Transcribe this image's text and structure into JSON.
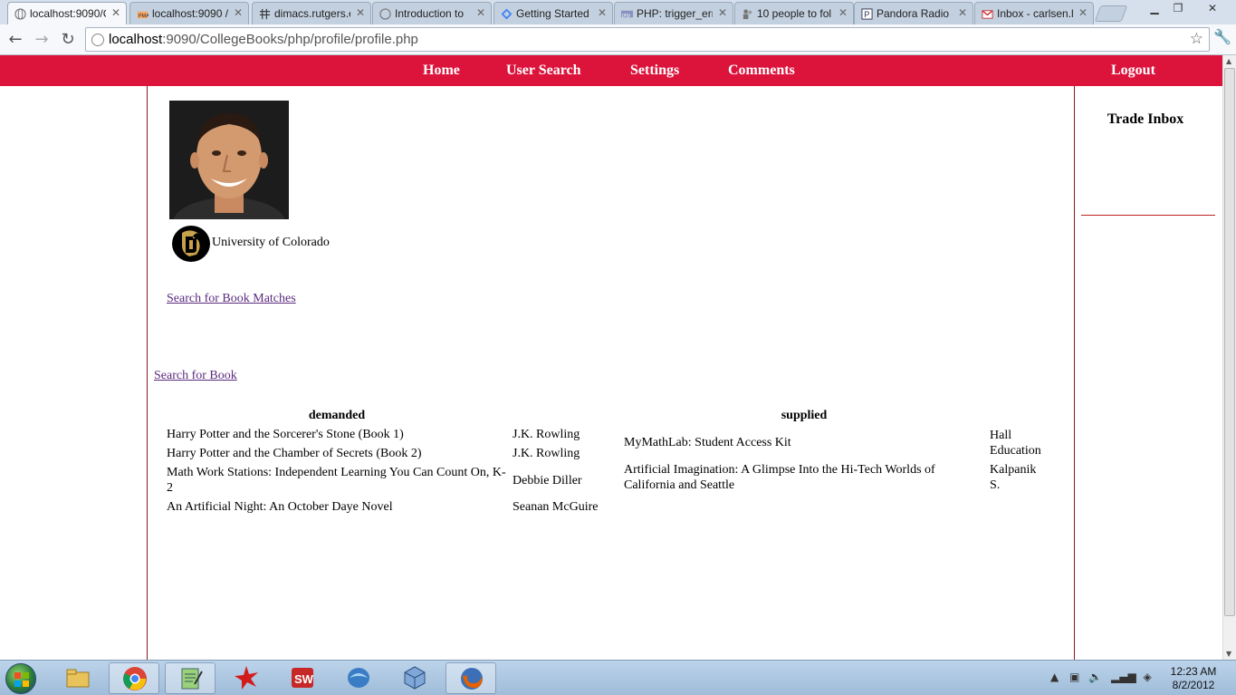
{
  "browser": {
    "tabs": [
      {
        "title": "localhost:9090/C",
        "active": true,
        "icon": "globe-icon"
      },
      {
        "title": "localhost:9090 /",
        "active": false,
        "icon": "phpmyadmin-icon"
      },
      {
        "title": "dimacs.rutgers.e",
        "active": false,
        "icon": "grid-icon"
      },
      {
        "title": "Introduction to",
        "active": false,
        "icon": "globe-icon"
      },
      {
        "title": "Getting Started",
        "active": false,
        "icon": "google-icon"
      },
      {
        "title": "PHP: trigger_err",
        "active": false,
        "icon": "php-icon"
      },
      {
        "title": "10 people to fol",
        "active": false,
        "icon": "people-icon"
      },
      {
        "title": "Pandora Radio -",
        "active": false,
        "icon": "pandora-icon"
      },
      {
        "title": "Inbox - carlsen.l",
        "active": false,
        "icon": "gmail-icon"
      }
    ],
    "url_host": "localhost",
    "url_rest": ":9090/CollegeBooks/php/profile/profile.php"
  },
  "nav": {
    "home": "Home",
    "user_search": "User Search",
    "settings": "Settings",
    "comments": "Comments",
    "logout": "Logout"
  },
  "profile": {
    "school_name": "University of Colorado",
    "search_matches_link": "Search for Book Matches",
    "search_book_link": "Search for Book"
  },
  "demanded": {
    "header": "demanded",
    "rows": [
      {
        "title": "Harry Potter and the Sorcerer's Stone (Book 1)",
        "author": "J.K. Rowling"
      },
      {
        "title": "Harry Potter and the Chamber of Secrets (Book 2)",
        "author": "J.K. Rowling"
      },
      {
        "title": "Math Work Stations: Independent Learning You Can Count On, K-2",
        "author": "Debbie Diller"
      },
      {
        "title": "An Artificial Night: An October Daye Novel",
        "author": "Seanan McGuire"
      }
    ]
  },
  "supplied": {
    "header": "supplied",
    "rows": [
      {
        "title": "MyMathLab: Student Access Kit",
        "author": "Hall Education"
      },
      {
        "title": "Artificial Imagination: A Glimpse Into the Hi-Tech Worlds of California and Seattle",
        "author": "Kalpanik S."
      }
    ]
  },
  "sidebar": {
    "trade_inbox_title": "Trade Inbox"
  },
  "taskbar": {
    "time": "12:23 AM",
    "date": "8/2/2012"
  },
  "colors": {
    "nav_bg": "#dc143c",
    "column_border": "#8b1a1a",
    "link": "#5a2a7e"
  }
}
